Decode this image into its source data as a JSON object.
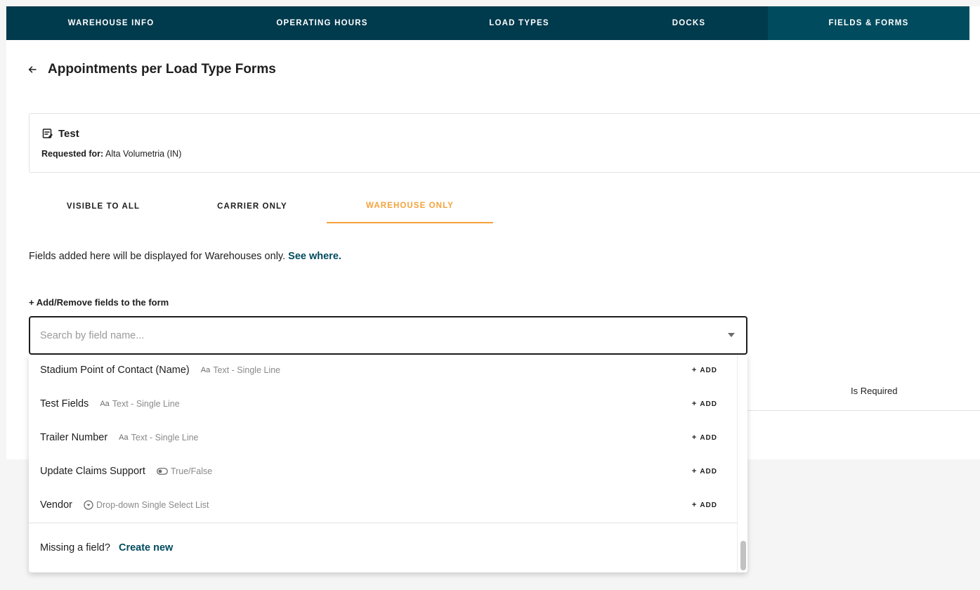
{
  "top_nav": {
    "tabs": [
      {
        "label": "WAREHOUSE INFO"
      },
      {
        "label": "OPERATING HOURS"
      },
      {
        "label": "LOAD TYPES"
      },
      {
        "label": "DOCKS"
      },
      {
        "label": "FIELDS & FORMS"
      }
    ],
    "active": "FIELDS & FORMS"
  },
  "page": {
    "title": "Appointments per Load Type Forms"
  },
  "card": {
    "title": "Test",
    "requested_label": "Requested for:",
    "requested_value": "Alta Volumetria (IN)"
  },
  "sub_tabs": {
    "tabs": [
      {
        "label": "VISIBLE TO ALL"
      },
      {
        "label": "CARRIER ONLY"
      },
      {
        "label": "WAREHOUSE ONLY"
      }
    ],
    "active": "WAREHOUSE ONLY"
  },
  "help": {
    "text": "Fields added here will be displayed for Warehouses only.",
    "link": "See where."
  },
  "add_fields": {
    "label": "+ Add/Remove fields to the form",
    "placeholder": "Search by field name..."
  },
  "table": {
    "is_required_header": "Is Required"
  },
  "dropdown": {
    "add_label": "ADD",
    "items": [
      {
        "name": "Stadium Point of Contact (Name)",
        "type": "Text - Single Line",
        "type_icon": "text-icon",
        "type_glyph": "Aa"
      },
      {
        "name": "Test Fields",
        "type": "Text - Single Line",
        "type_icon": "text-icon",
        "type_glyph": "Aa"
      },
      {
        "name": "Trailer Number",
        "type": "Text - Single Line",
        "type_icon": "text-icon",
        "type_glyph": "Aa"
      },
      {
        "name": "Update Claims Support",
        "type": "True/False",
        "type_icon": "toggle-icon",
        "type_glyph": ""
      },
      {
        "name": "Vendor",
        "type": "Drop-down Single Select List",
        "type_icon": "dropdown-circle-icon",
        "type_glyph": ""
      }
    ],
    "footer_text": "Missing a field?",
    "footer_link": "Create new"
  },
  "colors": {
    "nav_bg": "#003a4d",
    "nav_active": "#004b5e",
    "accent_orange": "#f5a23a",
    "link_teal": "#004b5e"
  }
}
